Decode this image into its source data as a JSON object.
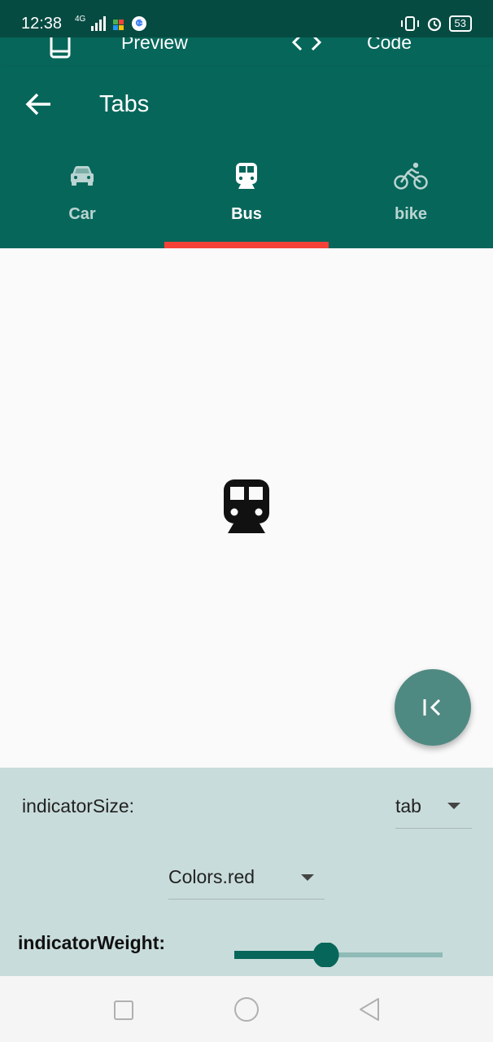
{
  "status_bar": {
    "time": "12:38",
    "network": "4G",
    "battery": "53",
    "icons": [
      "signal-icon",
      "puzzle-icon",
      "google-icon",
      "vibrate-icon",
      "alarm-icon",
      "battery-icon"
    ]
  },
  "preview_bar": {
    "preview_label": "Preview",
    "code_label": "Code"
  },
  "app_bar": {
    "title": "Tabs"
  },
  "tabs": [
    {
      "label": "Car",
      "icon": "car-icon",
      "selected": false
    },
    {
      "label": "Bus",
      "icon": "train-icon",
      "selected": true
    },
    {
      "label": "bike",
      "icon": "bike-icon",
      "selected": false
    }
  ],
  "content": {
    "icon": "train-icon"
  },
  "fab": {
    "icon": "first-page-icon"
  },
  "controls": {
    "indicator_size_label": "indicatorSize:",
    "indicator_size_value": "tab",
    "color_value": "Colors.red",
    "indicator_weight_label": "indicatorWeight:",
    "indicator_weight_level": 0.44
  },
  "colors": {
    "primary": "#07665a",
    "primary_dark": "#054b42",
    "indicator": "#f44336",
    "fab": "#4f8a82",
    "panel": "#c8dcdb"
  }
}
